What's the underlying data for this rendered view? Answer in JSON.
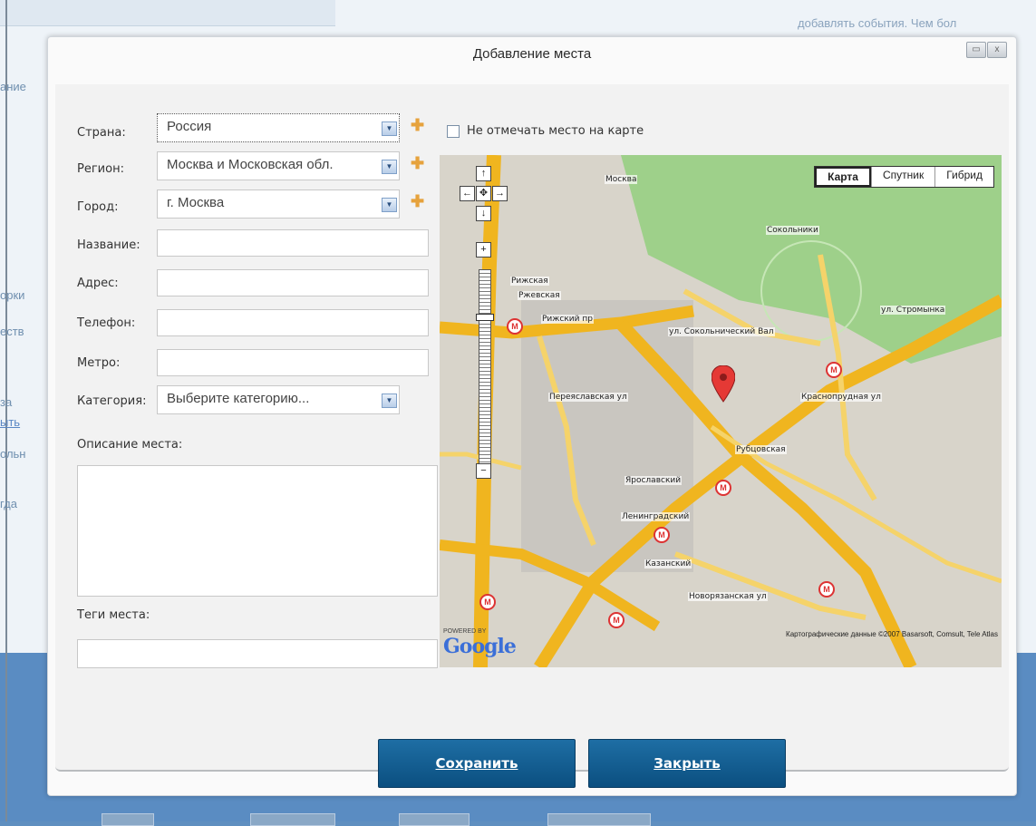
{
  "background": {
    "right_text": "добавлять события. Чем бол",
    "side_items": [
      "ание",
      "орки",
      "еств",
      "за",
      "ыть",
      "ольн",
      "гда"
    ]
  },
  "dialog": {
    "title": "Добавление места",
    "window_controls": [
      "▭",
      "x"
    ]
  },
  "form": {
    "country_label": "Страна:",
    "country_value": "Россия",
    "region_label": "Регион:",
    "region_value": "Москва и Московская обл.",
    "city_label": "Город:",
    "city_value": "г. Москва",
    "name_label": "Название:",
    "address_label": "Адрес:",
    "phone_label": "Телефон:",
    "metro_label": "Метро:",
    "category_label": "Категория:",
    "category_value": "Выберите категорию...",
    "description_label": "Описание места:",
    "tags_label": "Теги места:",
    "no_map_label": "Не отмечать место на карте"
  },
  "map": {
    "types": [
      "Карта",
      "Спутник",
      "Гибрид"
    ],
    "selected_type": "Карта",
    "labels": [
      "Москва",
      "Сокольники",
      "Рижская",
      "Ржевская",
      "Ярославский",
      "Ленинградский",
      "Казанский"
    ],
    "streets": [
      "ул. Сокольнический Вал",
      "Рижский пр",
      "Рубцовская",
      "ул. Стромынка",
      "Переяславская ул",
      "Краснопрудная ул",
      "Новорязанская ул"
    ],
    "logo": "Google",
    "logo_caption": "POWERED BY",
    "copyright": "Картографические данные ©2007 Basarsoft, Comsult, Tele Atlas"
  },
  "buttons": {
    "save": "Сохранить",
    "close": "Закрыть"
  }
}
